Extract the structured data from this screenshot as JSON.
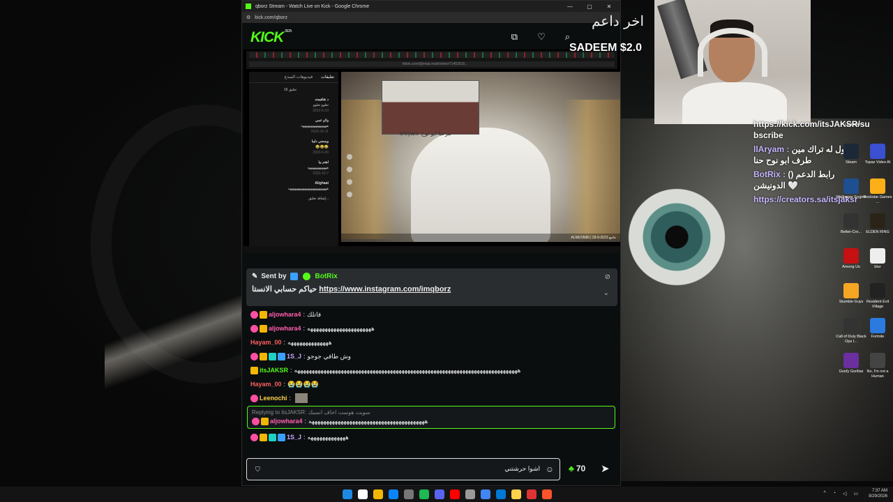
{
  "window": {
    "title": "qborz Stream - Watch Live on Kick - Google Chrome",
    "url": "kick.com/qborz",
    "controls": [
      "—",
      "▢",
      "✕"
    ]
  },
  "kick": {
    "logo": "KICK",
    "logo_badge": "BETA"
  },
  "stream": {
    "tt_tabs": [
      "تعليقات",
      "فيديوهات المبدع"
    ],
    "tt_count": "16 تعليق",
    "tt_comments": [
      {
        "name": "د نقلقيعند",
        "text": "تعلوو تعلوو",
        "date": "2023-5-23"
      },
      {
        "name": "ولاو عمي",
        "text": "ههههههههههههههههه",
        "date": "2023-10-11"
      },
      {
        "name": "وبسعي دايبا",
        "text": "😂😂😂",
        "date": "2023-6-20"
      },
      {
        "name": "اهتم بيا",
        "text": "ههههههههههههه",
        "date": "2023-10-7"
      },
      {
        "name": "Alighaat",
        "text": "ههههههههههههههههههههههههه",
        "date": ""
      }
    ],
    "tt_input_placeholder": "إضافة تعليق...",
    "overlay_user": "llAryam",
    "overlay_text": "مرحبا ابو نوح",
    "tt_footer": "ALMUTAIRI | جامع 2023-9-29"
  },
  "pinned": {
    "sent_by": "Sent by",
    "bot": "BotRix",
    "text_prefix": "حياكم حسابي الانستا",
    "link": "https://www.instagram.com/imqborz"
  },
  "chat": [
    {
      "user": "aljowhara4",
      "color": "#ff5fb0",
      "text": "فاتلك",
      "badges": [
        "pink",
        "gold"
      ]
    },
    {
      "user": "aljowhara4",
      "color": "#ff5fb0",
      "text": "ههههههههههههههههههههههه",
      "badges": [
        "pink",
        "gold"
      ]
    },
    {
      "user": "Hayam_00",
      "color": "#ff5f5f",
      "text": "ههههههههههههههه",
      "badges": []
    },
    {
      "user": "1S_J",
      "color": "#c9a7ff",
      "text": "وش طافي جوجو",
      "badges": [
        "pink",
        "gold",
        "teal",
        "blue"
      ]
    },
    {
      "user": "itsJAKSR",
      "color": "#53fc18",
      "text": "هههههههههههههههههههههههههههههههههههههههههههههههههههههههههههههههههههههههههههههه",
      "badges": [
        "gold"
      ]
    },
    {
      "user": "Hayam_00",
      "color": "#ff5f5f",
      "text": "😭😭😭😭",
      "badges": []
    },
    {
      "user": "Leenochi",
      "color": "#ffd24a",
      "text": "",
      "badges": [
        "pink"
      ],
      "image": true
    }
  ],
  "reply": {
    "label": "Replying to itsJAKSR: سويت هوست اخاف انسبك",
    "user": "aljowhara4",
    "color": "#ff5fb0",
    "text": "ههههههههههههههههههههههههههههههههههههههههه"
  },
  "chat_after": [
    {
      "user": "1S_J",
      "color": "#c9a7ff",
      "text": "هههههههههههههه",
      "badges": [
        "pink",
        "gold",
        "teal",
        "blue"
      ]
    }
  ],
  "chat_input": {
    "value": "اشوا حرشتني",
    "points": "70"
  },
  "overlay": {
    "donor_title": "اخر داعم",
    "donor_line": "SADEEM  $2.0",
    "chat": [
      {
        "prefix": "https://kick.com/itsJAKSR/su",
        "user": "",
        "text": "bscribe"
      },
      {
        "prefix": "",
        "user": "llAryam :",
        "text": "قول له تراك مين طرف ابو نوح حنا"
      },
      {
        "prefix": "",
        "user": "BotRix :",
        "text": "(رابط الدعم ( الدونيشن 🤍"
      },
      {
        "prefix": "",
        "user": "",
        "text": "https://creators.sa/itsjaksr"
      }
    ]
  },
  "desktop_icons": [
    {
      "label": "Launcher",
      "color": "#1a1a1a"
    },
    {
      "label": "Steam",
      "color": "#1b2838"
    },
    {
      "label": "Topaz Video AI",
      "color": "#3b4fd1"
    },
    {
      "label": "Wallpaper Engine",
      "color": "#1d4f91"
    },
    {
      "label": "Rockstar Games ...",
      "color": "#fcaf17"
    },
    {
      "label": "Better-Cre...",
      "color": "#333"
    },
    {
      "label": "ELDEN RING",
      "color": "#2a2418"
    },
    {
      "label": "Among Us",
      "color": "#c51111"
    },
    {
      "label": "blur",
      "color": "#eeeeee"
    },
    {
      "label": "Stumble Guys",
      "color": "#f5a623"
    },
    {
      "label": "Resident Evil Village",
      "color": "#222"
    },
    {
      "label": "Call of Duty Black Ops I...",
      "color": "#333"
    },
    {
      "label": "Fortnite",
      "color": "#2b7ae0"
    },
    {
      "label": "Goofy Gorillas",
      "color": "#6b2fa0"
    },
    {
      "label": "No, I'm not a Human",
      "color": "#444"
    }
  ],
  "tray": {
    "time": "7:37 AM",
    "date": "8/29/2026"
  },
  "taskbar_colors": [
    "#1e88e5",
    "#fff",
    "#f2b705",
    "#0a84ff",
    "#777",
    "#1db954",
    "#5865f2",
    "#ff0000",
    "#999",
    "#4285f4",
    "#0078d4",
    "#ffd24a",
    "#d33",
    "#fb542b"
  ]
}
